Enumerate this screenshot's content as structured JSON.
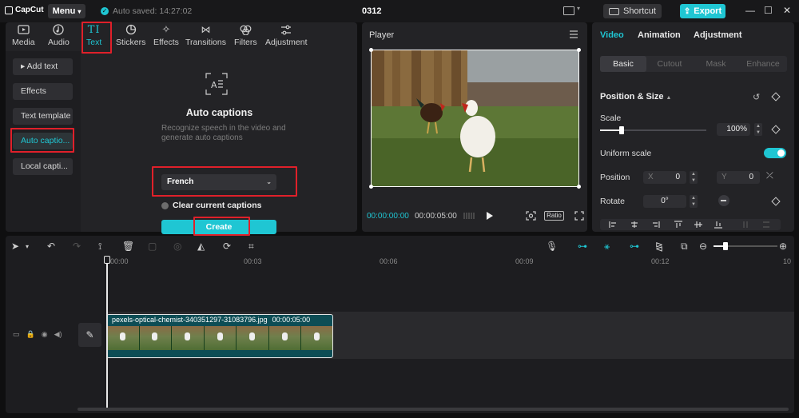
{
  "titlebar": {
    "app_name": "CapCut",
    "menu_label": "Menu",
    "autosave_text": "Auto saved: 14:27:02",
    "project_title": "0312",
    "shortcut_label": "Shortcut",
    "export_label": "Export"
  },
  "media_tabs": [
    {
      "label": "Media",
      "icon": "media-icon"
    },
    {
      "label": "Audio",
      "icon": "audio-icon"
    },
    {
      "label": "Text",
      "icon": "text-icon",
      "active": true
    },
    {
      "label": "Stickers",
      "icon": "sticker-icon"
    },
    {
      "label": "Effects",
      "icon": "effects-icon"
    },
    {
      "label": "Transitions",
      "icon": "transitions-icon"
    },
    {
      "label": "Filters",
      "icon": "filters-icon"
    },
    {
      "label": "Adjustment",
      "icon": "adjustment-icon"
    }
  ],
  "text_nav": [
    {
      "label": "▸ Add text"
    },
    {
      "label": "Effects"
    },
    {
      "label": "Text template"
    },
    {
      "label": "Auto captio...",
      "active": true
    },
    {
      "label": "Local capti..."
    }
  ],
  "auto_captions": {
    "title": "Auto captions",
    "description": "Recognize speech in the video and generate auto captions",
    "language": "French",
    "clear_label": "Clear current captions",
    "create_label": "Create"
  },
  "player": {
    "title": "Player",
    "time_current": "00:00:00:00",
    "time_total": "00:00:05:00",
    "ratio_label": "Ratio"
  },
  "properties": {
    "tabs": [
      "Video",
      "Animation",
      "Adjustment"
    ],
    "subtabs": [
      "Basic",
      "Cutout",
      "Mask",
      "Enhance"
    ],
    "section_title": "Position & Size",
    "scale_label": "Scale",
    "scale_value": "100%",
    "scale_fraction": 0.2,
    "uniform_label": "Uniform scale",
    "uniform_on": true,
    "position_label": "Position",
    "pos_x_label": "X",
    "pos_x": "0",
    "pos_y_label": "Y",
    "pos_y": "0",
    "rotate_label": "Rotate",
    "rotate_value": "0°"
  },
  "timeline": {
    "ticks": [
      "00:00",
      "00:03",
      "00:06",
      "00:09",
      "00:12",
      "10"
    ],
    "clip_name": "pexels-optical-chemist-340351297-31083796.jpg",
    "clip_duration": "00:00:05:00"
  },
  "colors": {
    "accent": "#1fc6d3",
    "highlight_box": "#e0202a"
  }
}
